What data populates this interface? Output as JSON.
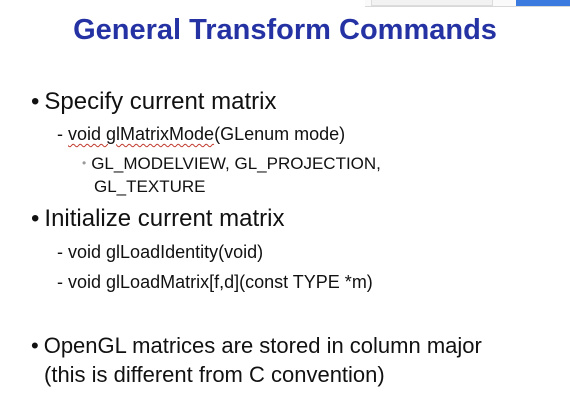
{
  "slide": {
    "title": "General Transform Commands",
    "bullets": {
      "b1": {
        "marker": "•",
        "text": "Specify current matrix"
      },
      "b1_sub1": {
        "marker": "-",
        "underlined": "void glMatrixMode",
        "rest": "(GLenum mode)"
      },
      "b1_sub1_detail": {
        "marker": "•",
        "line1": "GL_MODELVIEW, GL_PROJECTION,",
        "line2": "GL_TEXTURE"
      },
      "b2": {
        "marker": "•",
        "text": "Initialize current matrix"
      },
      "b2_sub1": {
        "marker": "-",
        "text": "void glLoadIdentity(void)"
      },
      "b2_sub2": {
        "marker": "-",
        "text": "void glLoadMatrix[f,d](const TYPE *m)"
      },
      "b3": {
        "marker": "•",
        "line1": "OpenGL matrices are stored in column major",
        "line2": "(this is different from C convention)"
      }
    },
    "annotation_color": "#c0392b",
    "title_color": "#2432a3"
  }
}
